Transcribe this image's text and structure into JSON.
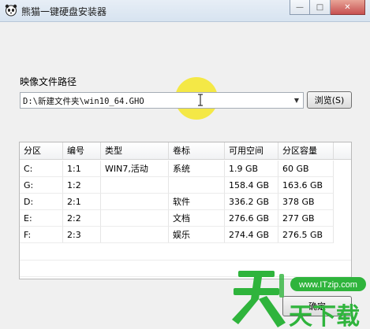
{
  "window": {
    "title": "熊猫一键硬盘安装器",
    "minimize_glyph": "—",
    "maximize_glyph": "□",
    "close_glyph": "✕"
  },
  "path": {
    "label": "映像文件路径",
    "value": "D:\\新建文件夹\\win10_64.GHO",
    "browse_label": "浏览(S)"
  },
  "table": {
    "columns": [
      "分区",
      "编号",
      "类型",
      "卷标",
      "可用空间",
      "分区容量"
    ],
    "rows": [
      [
        "C:",
        "1:1",
        "WIN7,活动",
        "系统",
        "1.9 GB",
        "60 GB"
      ],
      [
        "G:",
        "1:2",
        "",
        "",
        "158.4 GB",
        "163.6 GB"
      ],
      [
        "D:",
        "2:1",
        "",
        "软件",
        "336.2 GB",
        "378 GB"
      ],
      [
        "E:",
        "2:2",
        "",
        "文档",
        "276.6 GB",
        "277 GB"
      ],
      [
        "F:",
        "2:3",
        "",
        "娱乐",
        "274.4 GB",
        "276.5 GB"
      ]
    ]
  },
  "footer": {
    "ok_label": "确定"
  },
  "watermark": {
    "url": "www.ITzip.com",
    "brand": "天下载"
  },
  "colors": {
    "highlight": "#f5e628",
    "watermark_green": "#2fb43c"
  }
}
